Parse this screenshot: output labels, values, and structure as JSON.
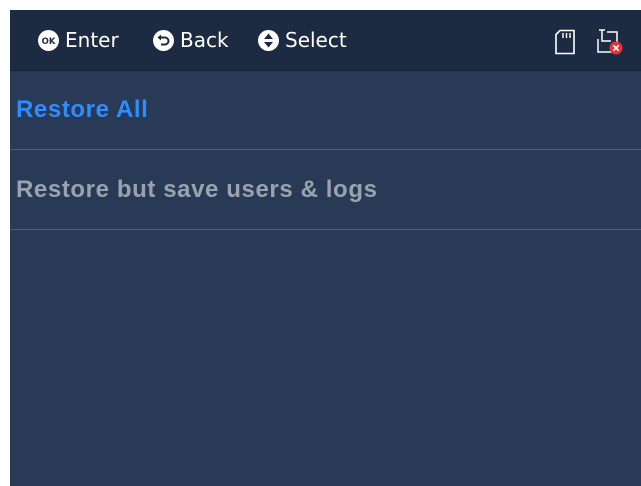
{
  "header": {
    "hints": [
      {
        "icon": "ok-button-icon",
        "label": "Enter"
      },
      {
        "icon": "back-arrow-icon",
        "label": "Back"
      },
      {
        "icon": "up-down-select-icon",
        "label": "Select"
      }
    ],
    "status_icons": [
      "sd-card-icon",
      "network-disconnected-icon"
    ]
  },
  "menu": {
    "items": [
      {
        "label": "Restore All",
        "selected": true
      },
      {
        "label": "Restore but save users & logs",
        "selected": false
      }
    ]
  },
  "colors": {
    "background": "#283a55",
    "header_background": "#1d2b42",
    "selected_text": "#2f8cff",
    "normal_text": "#9aa3ad",
    "divider": "#4e5e72",
    "error_badge": "#e8323a"
  }
}
